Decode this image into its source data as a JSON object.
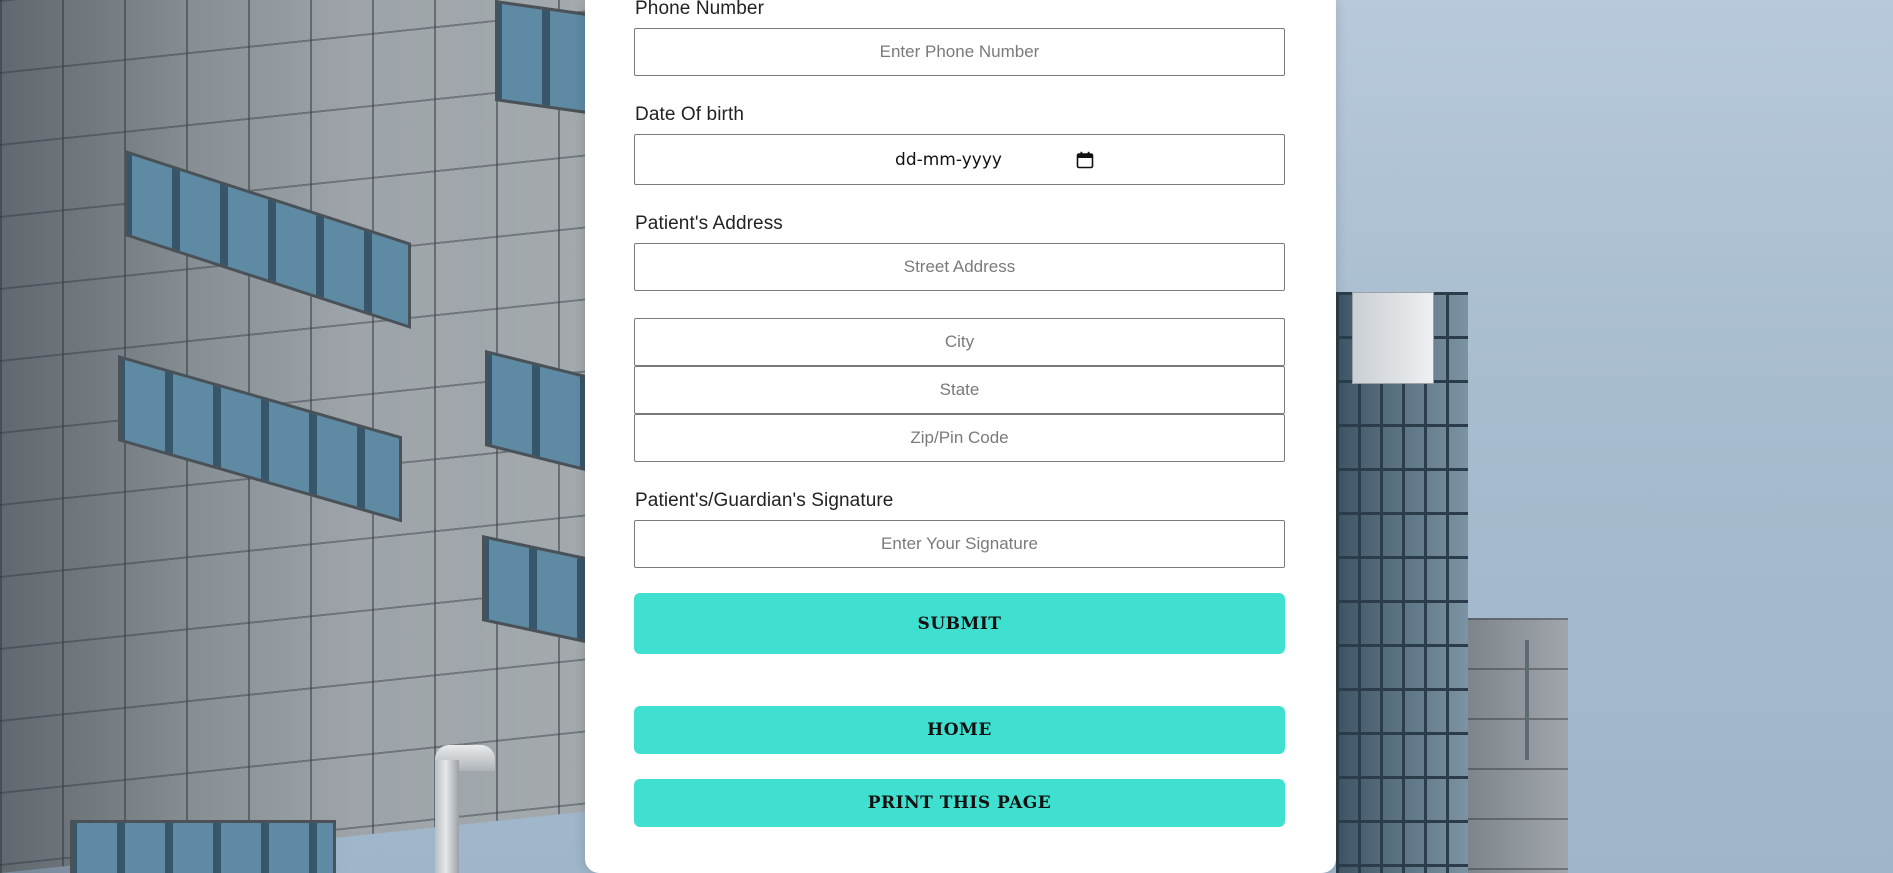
{
  "form": {
    "phone": {
      "label": "Phone Number",
      "placeholder": "Enter Phone Number"
    },
    "dob": {
      "label": "Date Of birth",
      "value": "dd-mm-yyyy"
    },
    "address": {
      "label": "Patient's Address",
      "street_placeholder": "Street Address",
      "city_placeholder": "City",
      "state_placeholder": "State",
      "zip_placeholder": "Zip/Pin Code"
    },
    "signature": {
      "label": "Patient's/Guardian's Signature",
      "placeholder": "Enter Your Signature"
    }
  },
  "buttons": {
    "submit": "SUBMIT",
    "home": "HOME",
    "print": "PRINT THIS PAGE"
  },
  "icons": {
    "date_picker": "calendar-icon"
  },
  "colors": {
    "accent": "#40e0d0",
    "panel": "#ffffff",
    "border": "#7a7a7a"
  }
}
